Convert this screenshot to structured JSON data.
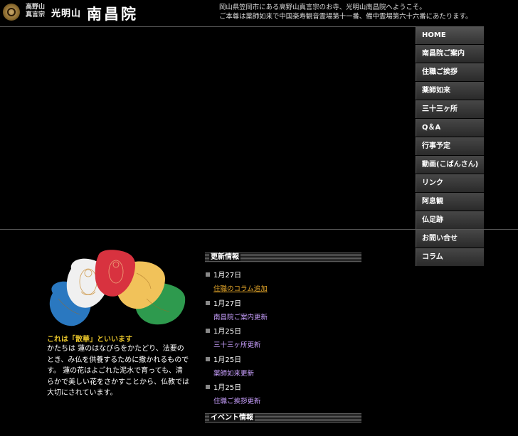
{
  "header": {
    "sect_line1": "高野山",
    "sect_line2": "真言宗",
    "mountain": "光明山",
    "temple_name": "南昌院",
    "welcome_line1": "岡山県笠岡市にある高野山真言宗のお寺、光明山南昌院へようこそ。",
    "welcome_line2": "ご本尊は薬師如来で中国楽寿観音霊場第十一番、備中霊場第六十六番にあたります。"
  },
  "nav": {
    "items": [
      {
        "label": "HOME"
      },
      {
        "label": "南昌院ご案内"
      },
      {
        "label": "住職ご挨拶"
      },
      {
        "label": "薬師如来"
      },
      {
        "label": "三十三ヶ所"
      },
      {
        "label": "Q＆A"
      },
      {
        "label": "行事予定"
      },
      {
        "label": "動画(こばんさん)"
      },
      {
        "label": "リンク"
      },
      {
        "label": "阿息観"
      },
      {
        "label": "仏足跡"
      },
      {
        "label": "お問い合せ"
      },
      {
        "label": "コラム"
      }
    ]
  },
  "sange": {
    "title": "これは「散華」といいます",
    "description": "かたちは 蓮のはなびらをかたどり、法要のとき、み仏を供養するために撒かれるものです。 蓮の花はよごれた泥水で育っても、清らかで美しい花をさかすことから、仏教では大切にされています。",
    "petal_colors": [
      "#2a78c0",
      "#f0f0f0",
      "#d8323f",
      "#f1c25a",
      "#2e9a4e"
    ]
  },
  "news": {
    "heading": "更新情報",
    "items": [
      {
        "date": "1月27日",
        "text": "住職のコラム追加"
      },
      {
        "date": "1月27日",
        "text": "南昌院ご案内更新"
      },
      {
        "date": "1月25日",
        "text": "三十三ヶ所更新"
      },
      {
        "date": "1月25日",
        "text": "薬師如来更新"
      },
      {
        "date": "1月25日",
        "text": "住職ご挨拶更新"
      }
    ]
  },
  "events": {
    "heading": "イベント情報"
  },
  "colors": {
    "link_first": "#e4a62a",
    "link_other": "#c9a0ff",
    "sange_title": "#e7c42a"
  }
}
